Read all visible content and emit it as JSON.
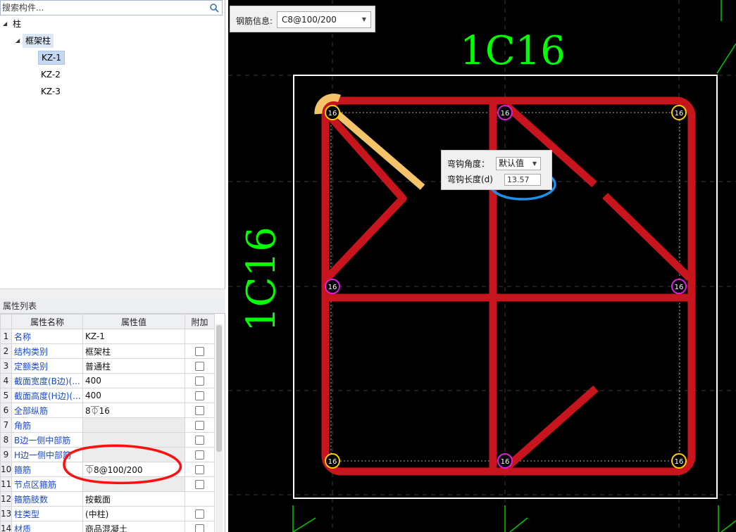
{
  "search": {
    "placeholder": "搜索构件..."
  },
  "tree": {
    "root_label": "柱",
    "group_label": "框架柱",
    "items": [
      "KZ-1",
      "KZ-2",
      "KZ-3"
    ]
  },
  "properties": {
    "title": "属性列表",
    "headers": {
      "name": "属性名称",
      "value": "属性值",
      "extra": "附加"
    },
    "rows": [
      {
        "num": "1",
        "name": "名称",
        "value": "KZ-1",
        "checkbox": false
      },
      {
        "num": "2",
        "name": "结构类别",
        "value": "框架柱",
        "checkbox": true
      },
      {
        "num": "3",
        "name": "定额类别",
        "value": "普通柱",
        "checkbox": true
      },
      {
        "num": "4",
        "name": "截面宽度(B边)(...",
        "value": "400",
        "checkbox": true
      },
      {
        "num": "5",
        "name": "截面高度(H边)(...",
        "value": "400",
        "checkbox": true
      },
      {
        "num": "6",
        "name": "全部纵筋",
        "value": "8⏁16",
        "checkbox": true
      },
      {
        "num": "7",
        "name": "角筋",
        "value": "",
        "checkbox": true
      },
      {
        "num": "8",
        "name": "B边一侧中部筋",
        "value": "",
        "checkbox": true
      },
      {
        "num": "9",
        "name": "H边一侧中部筋",
        "value": "",
        "checkbox": true
      },
      {
        "num": "10",
        "name": "箍筋",
        "value": "⏁8@100/200",
        "checkbox": true
      },
      {
        "num": "11",
        "name": "节点区箍筋",
        "value": "",
        "checkbox": true
      },
      {
        "num": "12",
        "name": "箍筋肢数",
        "value": "按截面",
        "checkbox": false
      },
      {
        "num": "13",
        "name": "柱类型",
        "value": "(中柱)",
        "checkbox": true
      },
      {
        "num": "14",
        "name": "材质",
        "value": "商品混凝土",
        "checkbox": true
      }
    ]
  },
  "canvas": {
    "rebar_info_label": "钢筋信息:",
    "rebar_info_value": "C8@100/200",
    "top_label": "1C16",
    "left_label": "1C16",
    "bar_label": "16",
    "hook": {
      "angle_label": "弯钩角度：",
      "angle_value": "默认值",
      "length_label": "弯钩长度(d)",
      "length_value": "13.57"
    }
  },
  "colors": {
    "rebar_red": "#c8141c",
    "highlight_orange": "#f4c36a",
    "label_green": "#00ff00",
    "corner_bar": "#ffd000",
    "middle_bar": "#e020e0",
    "annotation_blue": "#1e90e6",
    "annotation_red": "#ff1010"
  }
}
